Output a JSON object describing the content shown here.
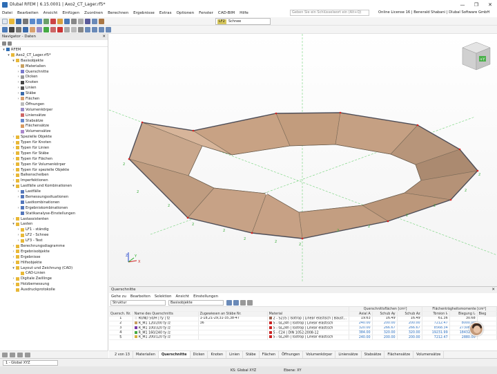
{
  "window": {
    "title": "Dlubal RFEM | 6.15.0001 | Axo2_CT_Lager.rf5*",
    "controls": [
      "—",
      "❐",
      "✕"
    ]
  },
  "menu": {
    "items": [
      "Datei",
      "Bearbeiten",
      "Ansicht",
      "Einfügen",
      "Zuordnen",
      "Berechnen",
      "Ergebnisse",
      "Extras",
      "Optionen",
      "Fenster",
      "CAD-BIM",
      "Hilfe"
    ],
    "search_placeholder": "Geben Sie ein Schlüsselwort ein (Alt+Q)",
    "license": "Online License 16 | Benerald Shabani | Dlubal Software GmbH"
  },
  "loadcase": {
    "code": "LF2",
    "name": "Schnee"
  },
  "navigator": {
    "title": "Navigator - Daten",
    "close": "✕",
    "items": [
      {
        "level": 0,
        "arrow": "▾",
        "icon": "#2e6db4",
        "label": "RFEM"
      },
      {
        "level": 1,
        "arrow": "▾",
        "icon": "#e8b838",
        "label": "Axo2_CT_Lager.rf5*"
      },
      {
        "level": 2,
        "arrow": "▾",
        "icon": "#e8b838",
        "label": "Basisobjekte"
      },
      {
        "level": 3,
        "arrow": "›",
        "icon": "#c8a060",
        "label": "Materialien"
      },
      {
        "level": 3,
        "arrow": "›",
        "icon": "#7a7acc",
        "label": "Querschnitte"
      },
      {
        "level": 3,
        "arrow": "›",
        "icon": "#999999",
        "label": "Dicken"
      },
      {
        "level": 3,
        "arrow": "›",
        "icon": "#444444",
        "label": "Knoten"
      },
      {
        "level": 3,
        "arrow": "›",
        "icon": "#555555",
        "label": "Linien"
      },
      {
        "level": 3,
        "arrow": "›",
        "icon": "#3a6aaa",
        "label": "Stäbe"
      },
      {
        "level": 3,
        "arrow": "›",
        "icon": "#d8a070",
        "label": "Flächen"
      },
      {
        "level": 3,
        "arrow": "",
        "icon": "#bbbbbb",
        "label": "Öffnungen"
      },
      {
        "level": 3,
        "arrow": "",
        "icon": "#9a8cc8",
        "label": "Volumenkörper"
      },
      {
        "level": 3,
        "arrow": "",
        "icon": "#cc6666",
        "label": "Liniensätze"
      },
      {
        "level": 3,
        "arrow": "",
        "icon": "#6688cc",
        "label": "Stabsätze"
      },
      {
        "level": 3,
        "arrow": "",
        "icon": "#d89a60",
        "label": "Flächensätze"
      },
      {
        "level": 3,
        "arrow": "",
        "icon": "#aa88cc",
        "label": "Volumensätze"
      },
      {
        "level": 2,
        "arrow": "›",
        "icon": "#e8b838",
        "label": "Spezielle Objekte"
      },
      {
        "level": 2,
        "arrow": "›",
        "icon": "#e8b838",
        "label": "Typen für Knoten"
      },
      {
        "level": 2,
        "arrow": "›",
        "icon": "#e8b838",
        "label": "Typen für Linien"
      },
      {
        "level": 2,
        "arrow": "›",
        "icon": "#e8b838",
        "label": "Typen für Stäbe"
      },
      {
        "level": 2,
        "arrow": "›",
        "icon": "#e8b838",
        "label": "Typen für Flächen"
      },
      {
        "level": 2,
        "arrow": "›",
        "icon": "#e8b838",
        "label": "Typen für Volumenkörper"
      },
      {
        "level": 2,
        "arrow": "›",
        "icon": "#e8b838",
        "label": "Typen für spezielle Objekte"
      },
      {
        "level": 2,
        "arrow": "›",
        "icon": "#e8b838",
        "label": "Balkenscheiben"
      },
      {
        "level": 2,
        "arrow": "›",
        "icon": "#e8b838",
        "label": "Imperfektionen"
      },
      {
        "level": 2,
        "arrow": "▾",
        "icon": "#e8b838",
        "label": "Lastfälle und Kombinationen"
      },
      {
        "level": 3,
        "arrow": "›",
        "icon": "#5577bb",
        "label": "Lastfälle"
      },
      {
        "level": 3,
        "arrow": "›",
        "icon": "#5577bb",
        "label": "Bemessungssituationen"
      },
      {
        "level": 3,
        "arrow": "",
        "icon": "#5577bb",
        "label": "Lastkombinationen"
      },
      {
        "level": 3,
        "arrow": "›",
        "icon": "#5577bb",
        "label": "Ergebniskombinationen"
      },
      {
        "level": 3,
        "arrow": "",
        "icon": "#5577bb",
        "label": "Statikanalyse-Einstellungen"
      },
      {
        "level": 2,
        "arrow": "›",
        "icon": "#e8b838",
        "label": "Lastassistenten"
      },
      {
        "level": 2,
        "arrow": "▾",
        "icon": "#e8b838",
        "label": "Lasten"
      },
      {
        "level": 3,
        "arrow": "›",
        "icon": "#e8b838",
        "label": "LF1 - ständig"
      },
      {
        "level": 3,
        "arrow": "›",
        "icon": "#e8b838",
        "label": "LF2 - Schnee"
      },
      {
        "level": 3,
        "arrow": "›",
        "icon": "#e8b838",
        "label": "LF3 - Test"
      },
      {
        "level": 2,
        "arrow": "›",
        "icon": "#e8b838",
        "label": "Berechnungsdiagramme"
      },
      {
        "level": 2,
        "arrow": "›",
        "icon": "#e8b838",
        "label": "Ergebnisobjekte"
      },
      {
        "level": 2,
        "arrow": "›",
        "icon": "#e8b838",
        "label": "Ergebnisse"
      },
      {
        "level": 2,
        "arrow": "›",
        "icon": "#e8b838",
        "label": "Hilfsobjekte"
      },
      {
        "level": 2,
        "arrow": "▾",
        "icon": "#e8b838",
        "label": "Layout und Zeichnung (CAD)"
      },
      {
        "level": 3,
        "arrow": "",
        "icon": "#e8b838",
        "label": "CAD-Linien"
      },
      {
        "level": 2,
        "arrow": "›",
        "icon": "#e8b838",
        "label": "Digitale Zwillinge"
      },
      {
        "level": 2,
        "arrow": "›",
        "icon": "#e8b838",
        "label": "Holzbemessung"
      },
      {
        "level": 2,
        "arrow": "",
        "icon": "#e8b838",
        "label": "Ausdruckprotokolle"
      }
    ]
  },
  "viewcube": {
    "face_label": "+Y"
  },
  "axes": {
    "x": "X",
    "y": "Y",
    "z": "Z"
  },
  "panel": {
    "title": "Querschnitte",
    "menu": [
      "Gehe zu",
      "Bearbeiten",
      "Selektion",
      "Ansicht",
      "Einstellungen"
    ],
    "selector1": "Struktur",
    "selector2": "Basisobjekte",
    "group_headers": {
      "areas": "Querschnittsflächen [cm²]",
      "moments": "Flächenträgheitsmomente [cm⁴]"
    },
    "columns": [
      "Quersch. Nr.",
      "Name des Querschnitts",
      "Zugewiesen an Stäbe Nr.",
      "Material",
      "Axial A",
      "Schub Ay",
      "Schub Az",
      "Torsion Iₜ",
      "Biegung Iᵧ",
      "Bieg"
    ],
    "rows": [
      {
        "no": "1",
        "color": "#e8e8e8",
        "name": "RUND 50/H | ty | tz",
        "members": "1-18,21-29,31-35,38-47",
        "mat_color": "#996655",
        "material": "2 - S235 | Isotrop | Linear elastisch | Baust...",
        "a": "19.63",
        "ay": "16.49",
        "az": "16.49",
        "it": "61.36",
        "iy": "30.68"
      },
      {
        "no": "2",
        "color": "#c8a060",
        "name": "R_M1 120/200 ty /z",
        "members": "36",
        "mat_color": "#cc2222",
        "material": "5 - GL24h | Isotrop | Linear elastisch",
        "a": "240.00",
        "ay": "200.00",
        "az": "200.00",
        "it": "7212.47",
        "iy": "8000.00"
      },
      {
        "no": "3",
        "color": "#7a3aaa",
        "name": "R_M1 100/320 ty /z",
        "members": "",
        "mat_color": "#cc2222",
        "material": "5 - GL24h | Isotrop | Linear elastisch",
        "a": "320.00",
        "ay": "266.67",
        "az": "266.67",
        "it": "8568.34",
        "iy": "27306.67"
      },
      {
        "no": "4",
        "color": "#44aa44",
        "name": "R_M1 160/240 ty /z",
        "members": "",
        "mat_color": "#cc2222",
        "material": "5 - C24 | DIN 1052:2008-12",
        "a": "384.00",
        "ay": "320.00",
        "az": "320.00",
        "it": "19231.99",
        "iy": "18432.00"
      },
      {
        "no": "5",
        "color": "#d8b040",
        "name": "R_M1 200/120 ty /z",
        "members": "",
        "mat_color": "#cc2222",
        "material": "5 - GL24h | Isotrop | Linear elastisch",
        "a": "240.00",
        "ay": "200.00",
        "az": "200.00",
        "it": "7212.47",
        "iy": "2880.00"
      }
    ],
    "pager": "2 von 13",
    "tabs": [
      "Materialien",
      "Querschnitte",
      "Dicken",
      "Knoten",
      "Linien",
      "Stäbe",
      "Flächen",
      "Öffnungen",
      "Volumenkörper",
      "Liniensätze",
      "Stabsätze",
      "Flächensätze",
      "Volumensätze"
    ],
    "active_tab": "Querschnitte"
  },
  "status": {
    "cs": "1 - Global XYZ",
    "coord_system": "KS: Global XYZ",
    "plane": "Ebene: XY"
  }
}
